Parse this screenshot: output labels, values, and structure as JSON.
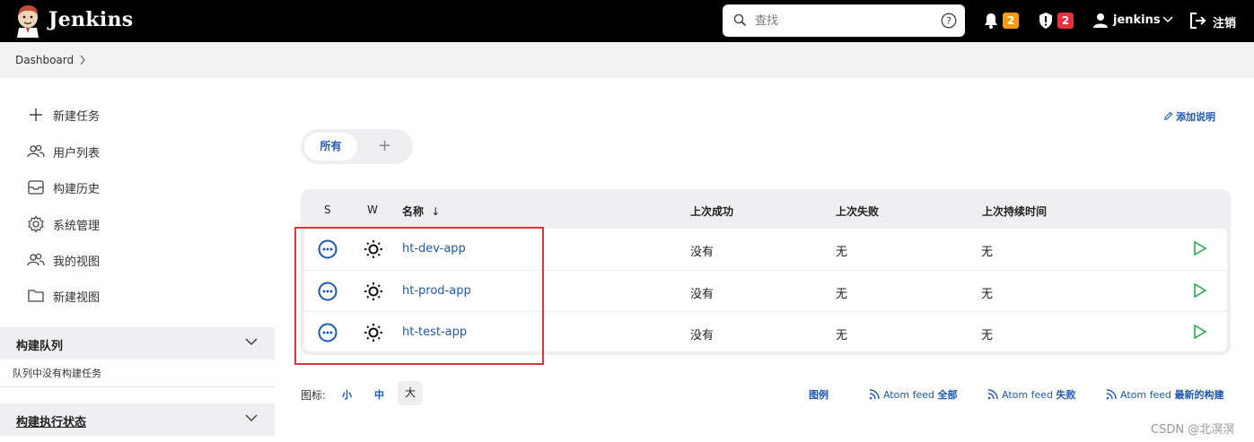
{
  "header": {
    "brand": "Jenkins",
    "search_placeholder": "查找",
    "notifications_count": "2",
    "security_count": "2",
    "user": "jenkins",
    "logout": "注销"
  },
  "breadcrumb": {
    "item": "Dashboard"
  },
  "sidebar": {
    "items": [
      {
        "label": "新建任务",
        "icon": "plus-icon"
      },
      {
        "label": "用户列表",
        "icon": "users-icon"
      },
      {
        "label": "构建历史",
        "icon": "inbox-icon"
      },
      {
        "label": "系统管理",
        "icon": "gear-icon"
      },
      {
        "label": "我的视图",
        "icon": "users-icon"
      },
      {
        "label": "新建视图",
        "icon": "folder-icon"
      }
    ],
    "queue_title": "构建队列",
    "queue_empty": "队列中没有构建任务",
    "executor_title": "构建执行状态"
  },
  "main": {
    "add_description": "添加说明",
    "tab_all": "所有",
    "tab_add": "+",
    "columns": {
      "s": "S",
      "w": "W",
      "name": "名称",
      "sort": "↓",
      "last_success": "上次成功",
      "last_failure": "上次失败",
      "last_duration": "上次持续时间"
    },
    "jobs": [
      {
        "name": "ht-dev-app",
        "last_success": "没有",
        "last_failure": "无",
        "last_duration": "无"
      },
      {
        "name": "ht-prod-app",
        "last_success": "没有",
        "last_failure": "无",
        "last_duration": "无"
      },
      {
        "name": "ht-test-app",
        "last_success": "没有",
        "last_failure": "无",
        "last_duration": "无"
      }
    ],
    "icon_label": "图标:",
    "size_s": "小",
    "size_m": "中",
    "size_l": "大",
    "legend": "图例",
    "feed_prefix": "Atom feed",
    "feed_all": "全部",
    "feed_failed": "失败",
    "feed_latest": "最新的构建"
  },
  "watermark": "CSDN @北溟溟",
  "colors": {
    "accent": "#1f58b5",
    "header_bg": "#000000",
    "badge_orange": "#fe9a12",
    "badge_red": "#e6323c",
    "run_green": "#1ea64b",
    "highlight_red": "#d9363e"
  }
}
